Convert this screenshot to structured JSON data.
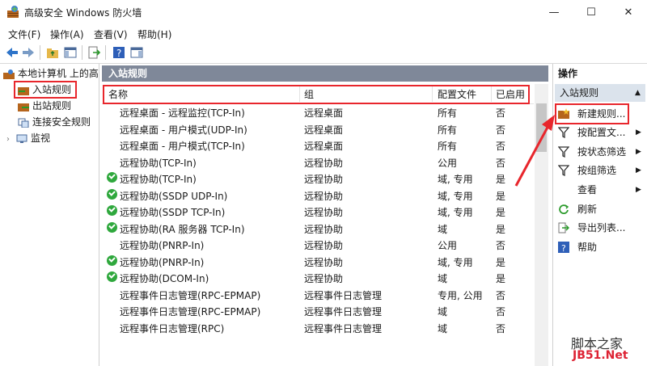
{
  "window": {
    "title": "高级安全 Windows 防火墙",
    "minimize": "—",
    "maximize": "☐",
    "close": "✕"
  },
  "menu": [
    "文件(F)",
    "操作(A)",
    "查看(V)",
    "帮助(H)"
  ],
  "tree": {
    "root": "本地计算机 上的高",
    "items": [
      "入站规则",
      "出站规则",
      "连接安全规则",
      "监视"
    ]
  },
  "center": {
    "header": "入站规则",
    "columns": [
      "名称",
      "组",
      "配置文件",
      "已启用"
    ],
    "rows": [
      {
        "name": "远程桌面 - 远程监控(TCP-In)",
        "group": "远程桌面",
        "profile": "所有",
        "enabled": "否",
        "on": false
      },
      {
        "name": "远程桌面 - 用户模式(UDP-In)",
        "group": "远程桌面",
        "profile": "所有",
        "enabled": "否",
        "on": false
      },
      {
        "name": "远程桌面 - 用户模式(TCP-In)",
        "group": "远程桌面",
        "profile": "所有",
        "enabled": "否",
        "on": false
      },
      {
        "name": "远程协助(TCP-In)",
        "group": "远程协助",
        "profile": "公用",
        "enabled": "否",
        "on": false
      },
      {
        "name": "远程协助(TCP-In)",
        "group": "远程协助",
        "profile": "域, 专用",
        "enabled": "是",
        "on": true
      },
      {
        "name": "远程协助(SSDP UDP-In)",
        "group": "远程协助",
        "profile": "域, 专用",
        "enabled": "是",
        "on": true
      },
      {
        "name": "远程协助(SSDP TCP-In)",
        "group": "远程协助",
        "profile": "域, 专用",
        "enabled": "是",
        "on": true
      },
      {
        "name": "远程协助(RA 服务器 TCP-In)",
        "group": "远程协助",
        "profile": "域",
        "enabled": "是",
        "on": true
      },
      {
        "name": "远程协助(PNRP-In)",
        "group": "远程协助",
        "profile": "公用",
        "enabled": "否",
        "on": false
      },
      {
        "name": "远程协助(PNRP-In)",
        "group": "远程协助",
        "profile": "域, 专用",
        "enabled": "是",
        "on": true
      },
      {
        "name": "远程协助(DCOM-In)",
        "group": "远程协助",
        "profile": "域",
        "enabled": "是",
        "on": true
      },
      {
        "name": "远程事件日志管理(RPC-EPMAP)",
        "group": "远程事件日志管理",
        "profile": "专用, 公用",
        "enabled": "否",
        "on": false
      },
      {
        "name": "远程事件日志管理(RPC-EPMAP)",
        "group": "远程事件日志管理",
        "profile": "域",
        "enabled": "否",
        "on": false
      },
      {
        "name": "远程事件日志管理(RPC)",
        "group": "远程事件日志管理",
        "profile": "域",
        "enabled": "否",
        "on": false
      }
    ]
  },
  "actions": {
    "title": "操作",
    "section": "入站规则",
    "items": [
      "新建规则...",
      "按配置文...",
      "按状态筛选",
      "按组筛选",
      "查看",
      "刷新",
      "导出列表...",
      "帮助"
    ]
  },
  "watermark": {
    "line1": "脚本之家",
    "line2": "JB51.Net"
  }
}
